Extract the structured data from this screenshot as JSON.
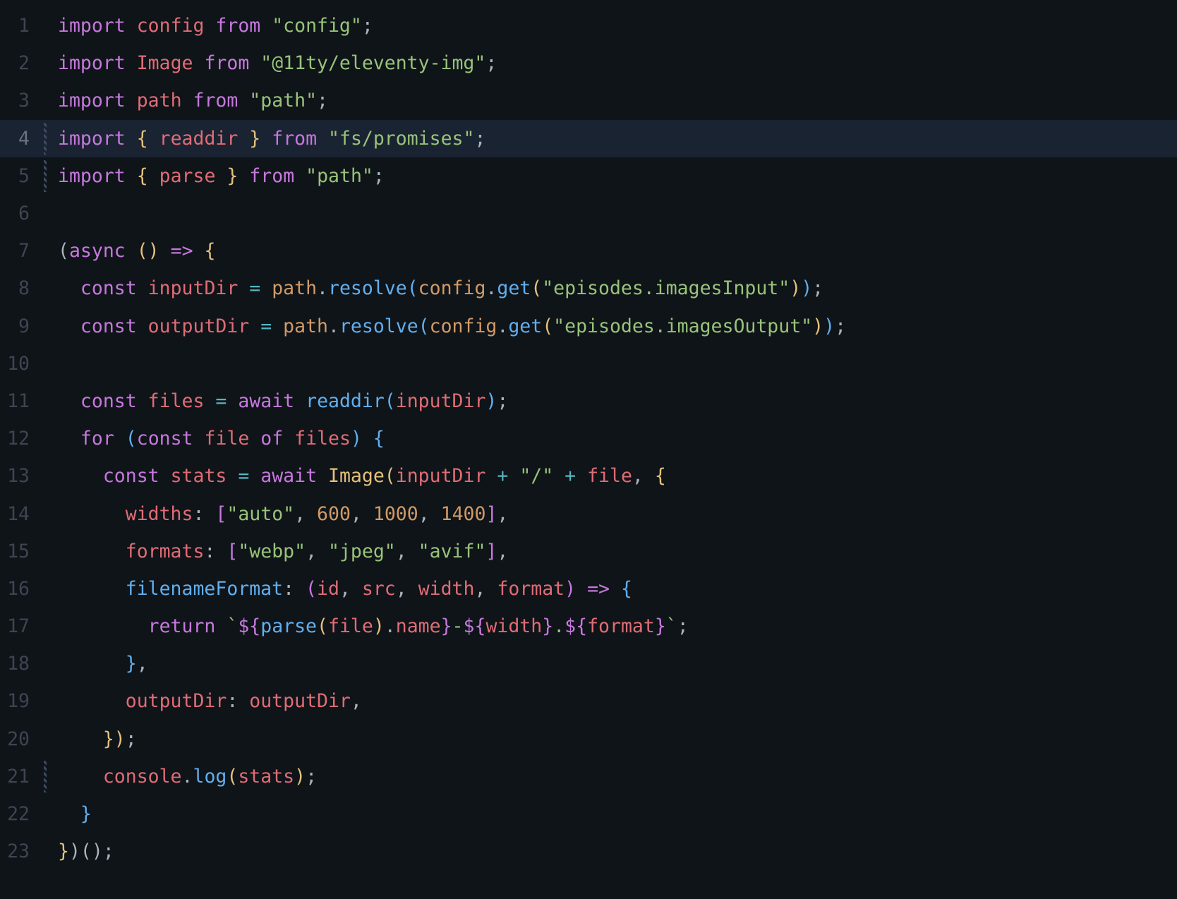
{
  "language": "javascript",
  "theme": "dark",
  "lines": [
    {
      "n": 1,
      "html": "<span class='kw'>import</span> <span class='ident'>config</span> <span class='kw'>from</span> <span class='str'>\"config\"</span><span class='def'>;</span>"
    },
    {
      "n": 2,
      "html": "<span class='kw'>import</span> <span class='ident'>Image</span> <span class='kw'>from</span> <span class='str'>\"@11ty/eleventy-img\"</span><span class='def'>;</span>"
    },
    {
      "n": 3,
      "html": "<span class='kw'>import</span> <span class='ident'>path</span> <span class='kw'>from</span> <span class='str'>\"path\"</span><span class='def'>;</span>"
    },
    {
      "n": 4,
      "html": "<span class='kw'>import</span> <span class='brace'>{</span> <span class='ident'>readdir</span> <span class='brace'>}</span> <span class='kw'>from</span> <span class='str'>\"fs/promises\"</span><span class='def'>;</span>",
      "hl": true,
      "mod": true
    },
    {
      "n": 5,
      "html": "<span class='kw'>import</span> <span class='brace'>{</span> <span class='ident'>parse</span> <span class='brace'>}</span> <span class='kw'>from</span> <span class='str'>\"path\"</span><span class='def'>;</span>",
      "mod": true
    },
    {
      "n": 6,
      "html": ""
    },
    {
      "n": 7,
      "html": "<span class='def'>(</span><span class='kw'>async</span> <span class='brace'>()</span> <span class='kw'>=&gt;</span> <span class='brace'>{</span>"
    },
    {
      "n": 8,
      "html": "  <span class='kw'>const</span> <span class='ident'>inputDir</span> <span class='op'>=</span> <span class='var2'>path</span><span class='def'>.</span><span class='fn'>resolve</span><span class='brblue'>(</span><span class='var2'>config</span><span class='def'>.</span><span class='fn'>get</span><span class='brace'>(</span><span class='str'>\"episodes.imagesInput\"</span><span class='brace'>)</span><span class='brblue'>)</span><span class='def'>;</span>"
    },
    {
      "n": 9,
      "html": "  <span class='kw'>const</span> <span class='ident'>outputDir</span> <span class='op'>=</span> <span class='var2'>path</span><span class='def'>.</span><span class='fn'>resolve</span><span class='brblue'>(</span><span class='var2'>config</span><span class='def'>.</span><span class='fn'>get</span><span class='brace'>(</span><span class='str'>\"episodes.imagesOutput\"</span><span class='brace'>)</span><span class='brblue'>)</span><span class='def'>;</span>"
    },
    {
      "n": 10,
      "html": ""
    },
    {
      "n": 11,
      "html": "  <span class='kw'>const</span> <span class='ident'>files</span> <span class='op'>=</span> <span class='kw'>await</span> <span class='fn'>readdir</span><span class='brblue'>(</span><span class='ident'>inputDir</span><span class='brblue'>)</span><span class='def'>;</span>"
    },
    {
      "n": 12,
      "html": "  <span class='kw'>for</span> <span class='brblue'>(</span><span class='kw'>const</span> <span class='ident'>file</span> <span class='kw'>of</span> <span class='ident'>files</span><span class='brblue'>)</span> <span class='brblue'>{</span>"
    },
    {
      "n": 13,
      "html": "    <span class='kw'>const</span> <span class='ident'>stats</span> <span class='op'>=</span> <span class='kw'>await</span> <span class='ty'>Image</span><span class='brace'>(</span><span class='ident'>inputDir</span> <span class='op'>+</span> <span class='str'>\"/\"</span> <span class='op'>+</span> <span class='ident'>file</span><span class='def'>,</span> <span class='brace'>{</span>"
    },
    {
      "n": 14,
      "html": "      <span class='ident'>widths</span><span class='def'>:</span> <span class='kw'>[</span><span class='str'>\"auto\"</span><span class='def'>,</span> <span class='num'>600</span><span class='def'>,</span> <span class='num'>1000</span><span class='def'>,</span> <span class='num'>1400</span><span class='kw'>]</span><span class='def'>,</span>"
    },
    {
      "n": 15,
      "html": "      <span class='ident'>formats</span><span class='def'>:</span> <span class='kw'>[</span><span class='str'>\"webp\"</span><span class='def'>,</span> <span class='str'>\"jpeg\"</span><span class='def'>,</span> <span class='str'>\"avif\"</span><span class='kw'>]</span><span class='def'>,</span>"
    },
    {
      "n": 16,
      "html": "      <span class='fn'>filenameFormat</span><span class='def'>:</span> <span class='kw'>(</span><span class='ident'>id</span><span class='def'>,</span> <span class='ident'>src</span><span class='def'>,</span> <span class='ident'>width</span><span class='def'>,</span> <span class='ident'>format</span><span class='kw'>)</span> <span class='kw'>=&gt;</span> <span class='brblue'>{</span>"
    },
    {
      "n": 17,
      "html": "        <span class='kw'>return</span> <span class='str'>`</span><span class='kw'>${</span><span class='fn'>parse</span><span class='brace'>(</span><span class='ident'>file</span><span class='brace'>)</span><span class='def'>.</span><span class='ident'>name</span><span class='kw'>}</span><span class='str'>-</span><span class='kw'>${</span><span class='ident'>width</span><span class='kw'>}</span><span class='str'>.</span><span class='kw'>${</span><span class='ident'>format</span><span class='kw'>}</span><span class='str'>`</span><span class='def'>;</span>"
    },
    {
      "n": 18,
      "html": "      <span class='brblue'>}</span><span class='def'>,</span>"
    },
    {
      "n": 19,
      "html": "      <span class='ident'>outputDir</span><span class='def'>:</span> <span class='ident'>outputDir</span><span class='def'>,</span>"
    },
    {
      "n": 20,
      "html": "    <span class='brace'>}</span><span class='brace'>)</span><span class='def'>;</span>"
    },
    {
      "n": 21,
      "html": "    <span class='ident'>console</span><span class='def'>.</span><span class='fn'>log</span><span class='brace'>(</span><span class='ident'>stats</span><span class='brace'>)</span><span class='def'>;</span>",
      "mod": true
    },
    {
      "n": 22,
      "html": "  <span class='brblue'>}</span>"
    },
    {
      "n": 23,
      "html": "<span class='brace'>}</span><span class='def'>)()</span><span class='def'>;</span>"
    }
  ],
  "raw_code": "import config from \"config\";\nimport Image from \"@11ty/eleventy-img\";\nimport path from \"path\";\nimport { readdir } from \"fs/promises\";\nimport { parse } from \"path\";\n\n(async () => {\n  const inputDir = path.resolve(config.get(\"episodes.imagesInput\"));\n  const outputDir = path.resolve(config.get(\"episodes.imagesOutput\"));\n\n  const files = await readdir(inputDir);\n  for (const file of files) {\n    const stats = await Image(inputDir + \"/\" + file, {\n      widths: [\"auto\", 600, 1000, 1400],\n      formats: [\"webp\", \"jpeg\", \"avif\"],\n      filenameFormat: (id, src, width, format) => {\n        return `${parse(file).name}-${width}.${format}`;\n      },\n      outputDir: outputDir,\n    });\n    console.log(stats);\n  }\n})();"
}
